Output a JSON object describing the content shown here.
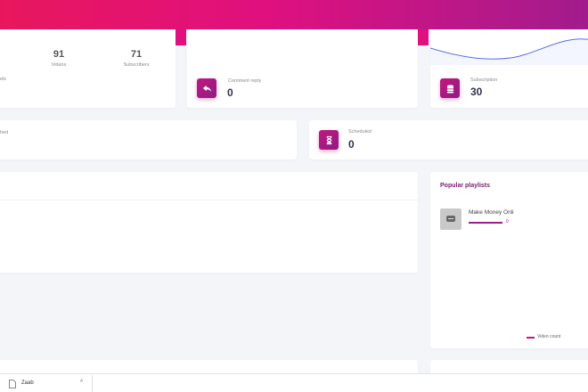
{
  "stats": {
    "videos_value": "91",
    "videos_label": "Videos",
    "subscribers_value": "71",
    "subscribers_label": "Subscribers",
    "partial_left_label": "els"
  },
  "comment_reply": {
    "label": "Comment reply",
    "value": "0",
    "icon": "reply-icon"
  },
  "subscription": {
    "label": "Subscription",
    "value": "30",
    "icon": "coins-icon"
  },
  "published": {
    "label_partial": "hed"
  },
  "scheduled": {
    "label": "Scheduled",
    "value": "0",
    "icon": "hourglass-icon"
  },
  "popular_playlists": {
    "title": "Popular playlists",
    "items": [
      {
        "name": "Make Money Onli",
        "count": "0",
        "icon": "playlist-thumb-icon"
      }
    ],
    "legend": "Video count"
  },
  "taskbar": {
    "item_label": "Zaab",
    "chevron": "^"
  },
  "colors": {
    "accent": "#c2187e",
    "gradient_start": "#e8175d",
    "gradient_end": "#a21c8d"
  }
}
